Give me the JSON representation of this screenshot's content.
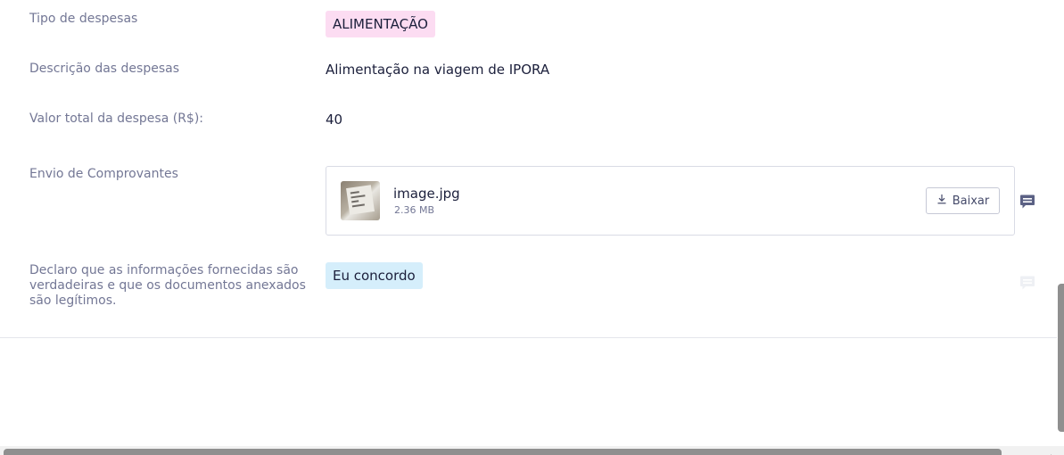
{
  "fields": {
    "expense_type": {
      "label": "Tipo de despesas",
      "value": "ALIMENTAÇÃO"
    },
    "expense_description": {
      "label": "Descrição das despesas",
      "value": "Alimentação na viagem de IPORA"
    },
    "expense_total": {
      "label": "Valor total da despesa (R$):",
      "value": "40"
    },
    "receipts": {
      "label": "Envio de Comprovantes",
      "file_name": "image.jpg",
      "file_size": "2.36 MB",
      "download_label": "Baixar"
    },
    "declaration": {
      "label": "Declaro que as informações fornecidas são verdadeiras e que os documentos anexados são legítimos.",
      "value": "Eu concordo"
    }
  },
  "colors": {
    "tag_pink": "#fcdcf2",
    "tag_blue": "#d5eefb",
    "comment_icon_active": "#5b6184",
    "comment_icon_faded": "#eef0f4"
  },
  "icons": {
    "comment": "comment-icon",
    "download": "download-icon"
  }
}
